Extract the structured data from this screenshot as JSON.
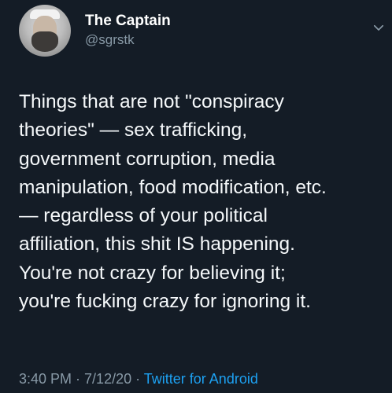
{
  "author": {
    "display_name": "The Captain",
    "handle": "@sgrstk"
  },
  "tweet": {
    "text": "Things that are not \"conspiracy\ntheories\" — sex trafficking,\ngovernment corruption, media\nmanipulation, food modification, etc.\n— regardless of your political\naffiliation, this shit IS happening.\nYou're not crazy for believing it;\nyou're fucking crazy for ignoring it."
  },
  "meta": {
    "time": "3:40 PM",
    "sep1": " · ",
    "date": "7/12/20",
    "sep2": " · ",
    "source": "Twitter for Android"
  },
  "icons": {
    "menu": "chevron-down-icon",
    "avatar": "avatar"
  },
  "colors": {
    "background": "#141c26",
    "text": "#f5f8fa",
    "secondary": "#8899a6",
    "link": "#1da1f2"
  }
}
